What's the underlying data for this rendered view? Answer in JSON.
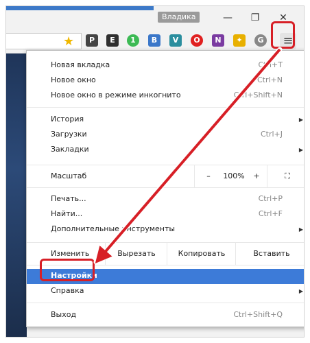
{
  "window": {
    "profile_name": "Владика",
    "minimize_glyph": "—",
    "maximize_glyph": "❐",
    "close_glyph": "✕"
  },
  "toolbar": {
    "bookmark_icon": "star-icon",
    "menu_icon": "hamburger-menu-icon",
    "menu_glyph": "≡",
    "extensions": [
      {
        "name": "pocket-icon",
        "glyph": "P",
        "color": "#444444"
      },
      {
        "name": "evernote-icon",
        "glyph": "E",
        "color": "#2f2f2f"
      },
      {
        "name": "ublock-icon",
        "glyph": "1",
        "color": "#3cba54"
      },
      {
        "name": "briefcase-icon",
        "glyph": "B",
        "color": "#3b77c9"
      },
      {
        "name": "vpn-shield-icon",
        "glyph": "V",
        "color": "#2a8e9e"
      },
      {
        "name": "opera-icon",
        "glyph": "O",
        "color": "#e02020"
      },
      {
        "name": "onenote-icon",
        "glyph": "N",
        "color": "#7a3ba1"
      },
      {
        "name": "apps-icon",
        "glyph": "✦",
        "color": "#e8b000"
      },
      {
        "name": "ghost-icon",
        "glyph": "G",
        "color": "#888888"
      }
    ]
  },
  "menu": {
    "new_tab": {
      "label": "Новая вкладка",
      "shortcut": "Ctrl+T"
    },
    "new_window": {
      "label": "Новое окно",
      "shortcut": "Ctrl+N"
    },
    "incognito": {
      "label": "Новое окно в режиме инкогнито",
      "shortcut": "Ctrl+Shift+N"
    },
    "history": {
      "label": "История"
    },
    "downloads": {
      "label": "Загрузки",
      "shortcut": "Ctrl+J"
    },
    "bookmarks": {
      "label": "Закладки"
    },
    "zoom": {
      "label": "Масштаб",
      "minus": "–",
      "value": "100%",
      "plus": "+",
      "fullscreen": "⛶"
    },
    "print": {
      "label": "Печать...",
      "shortcut": "Ctrl+P"
    },
    "find": {
      "label": "Найти...",
      "shortcut": "Ctrl+F"
    },
    "more_tools": {
      "label": "Дополнительные инструменты"
    },
    "edit": {
      "label": "Изменить",
      "cut": "Вырезать",
      "copy": "Копировать",
      "paste": "Вставить"
    },
    "settings": {
      "label": "Настройки"
    },
    "help": {
      "label": "Справка"
    },
    "exit": {
      "label": "Выход",
      "shortcut": "Ctrl+Shift+Q"
    },
    "submenu_arrow": "▶"
  },
  "annotation": {
    "color": "#d71f26"
  }
}
